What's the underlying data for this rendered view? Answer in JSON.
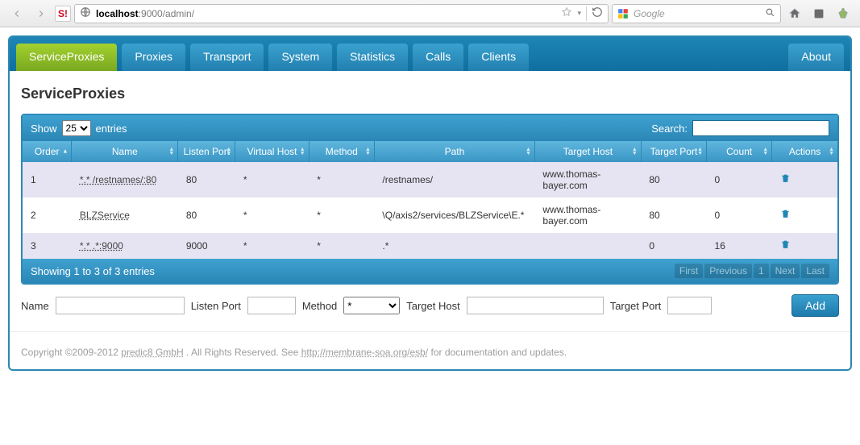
{
  "browser": {
    "url_host": "localhost",
    "url_rest": ":9000/admin/",
    "search_placeholder": "Google"
  },
  "tabs": {
    "items": [
      "ServiceProxies",
      "Proxies",
      "Transport",
      "System",
      "Statistics",
      "Calls",
      "Clients"
    ],
    "right": "About",
    "active_index": 0
  },
  "page_title": "ServiceProxies",
  "datatable": {
    "length_menu": {
      "show": "Show",
      "value": "25",
      "entries": "entries"
    },
    "search_label": "Search:",
    "columns": [
      "Order",
      "Name",
      "Listen Port",
      "Virtual Host",
      "Method",
      "Path",
      "Target Host",
      "Target Port",
      "Count",
      "Actions"
    ],
    "rows": [
      {
        "order": "1",
        "name": "*.* /restnames/:80",
        "listen_port": "80",
        "vhost": "*",
        "method": "*",
        "path": "/restnames/",
        "thost": "www.thomas-bayer.com",
        "tport": "80",
        "count": "0"
      },
      {
        "order": "2",
        "name": "BLZService",
        "listen_port": "80",
        "vhost": "*",
        "method": "*",
        "path": "\\Q/axis2/services/BLZService\\E.*",
        "thost": "www.thomas-bayer.com",
        "tport": "80",
        "count": "0"
      },
      {
        "order": "3",
        "name": "*.* .*:9000",
        "listen_port": "9000",
        "vhost": "*",
        "method": "*",
        "path": ".*",
        "thost": "",
        "tport": "0",
        "count": "16"
      }
    ],
    "info": "Showing 1 to 3 of 3 entries",
    "pager": [
      "First",
      "Previous",
      "1",
      "Next",
      "Last"
    ]
  },
  "addform": {
    "name_label": "Name",
    "listen_port_label": "Listen Port",
    "method_label": "Method",
    "method_value": "*",
    "target_host_label": "Target Host",
    "target_port_label": "Target Port",
    "add_label": "Add"
  },
  "footer": {
    "pre": "Copyright ©2009-2012 ",
    "company": "predic8 GmbH",
    "mid": ". All Rights Reserved. See ",
    "doc_url": "http://membrane-soa.org/esb/",
    "post": " for documentation and updates."
  }
}
